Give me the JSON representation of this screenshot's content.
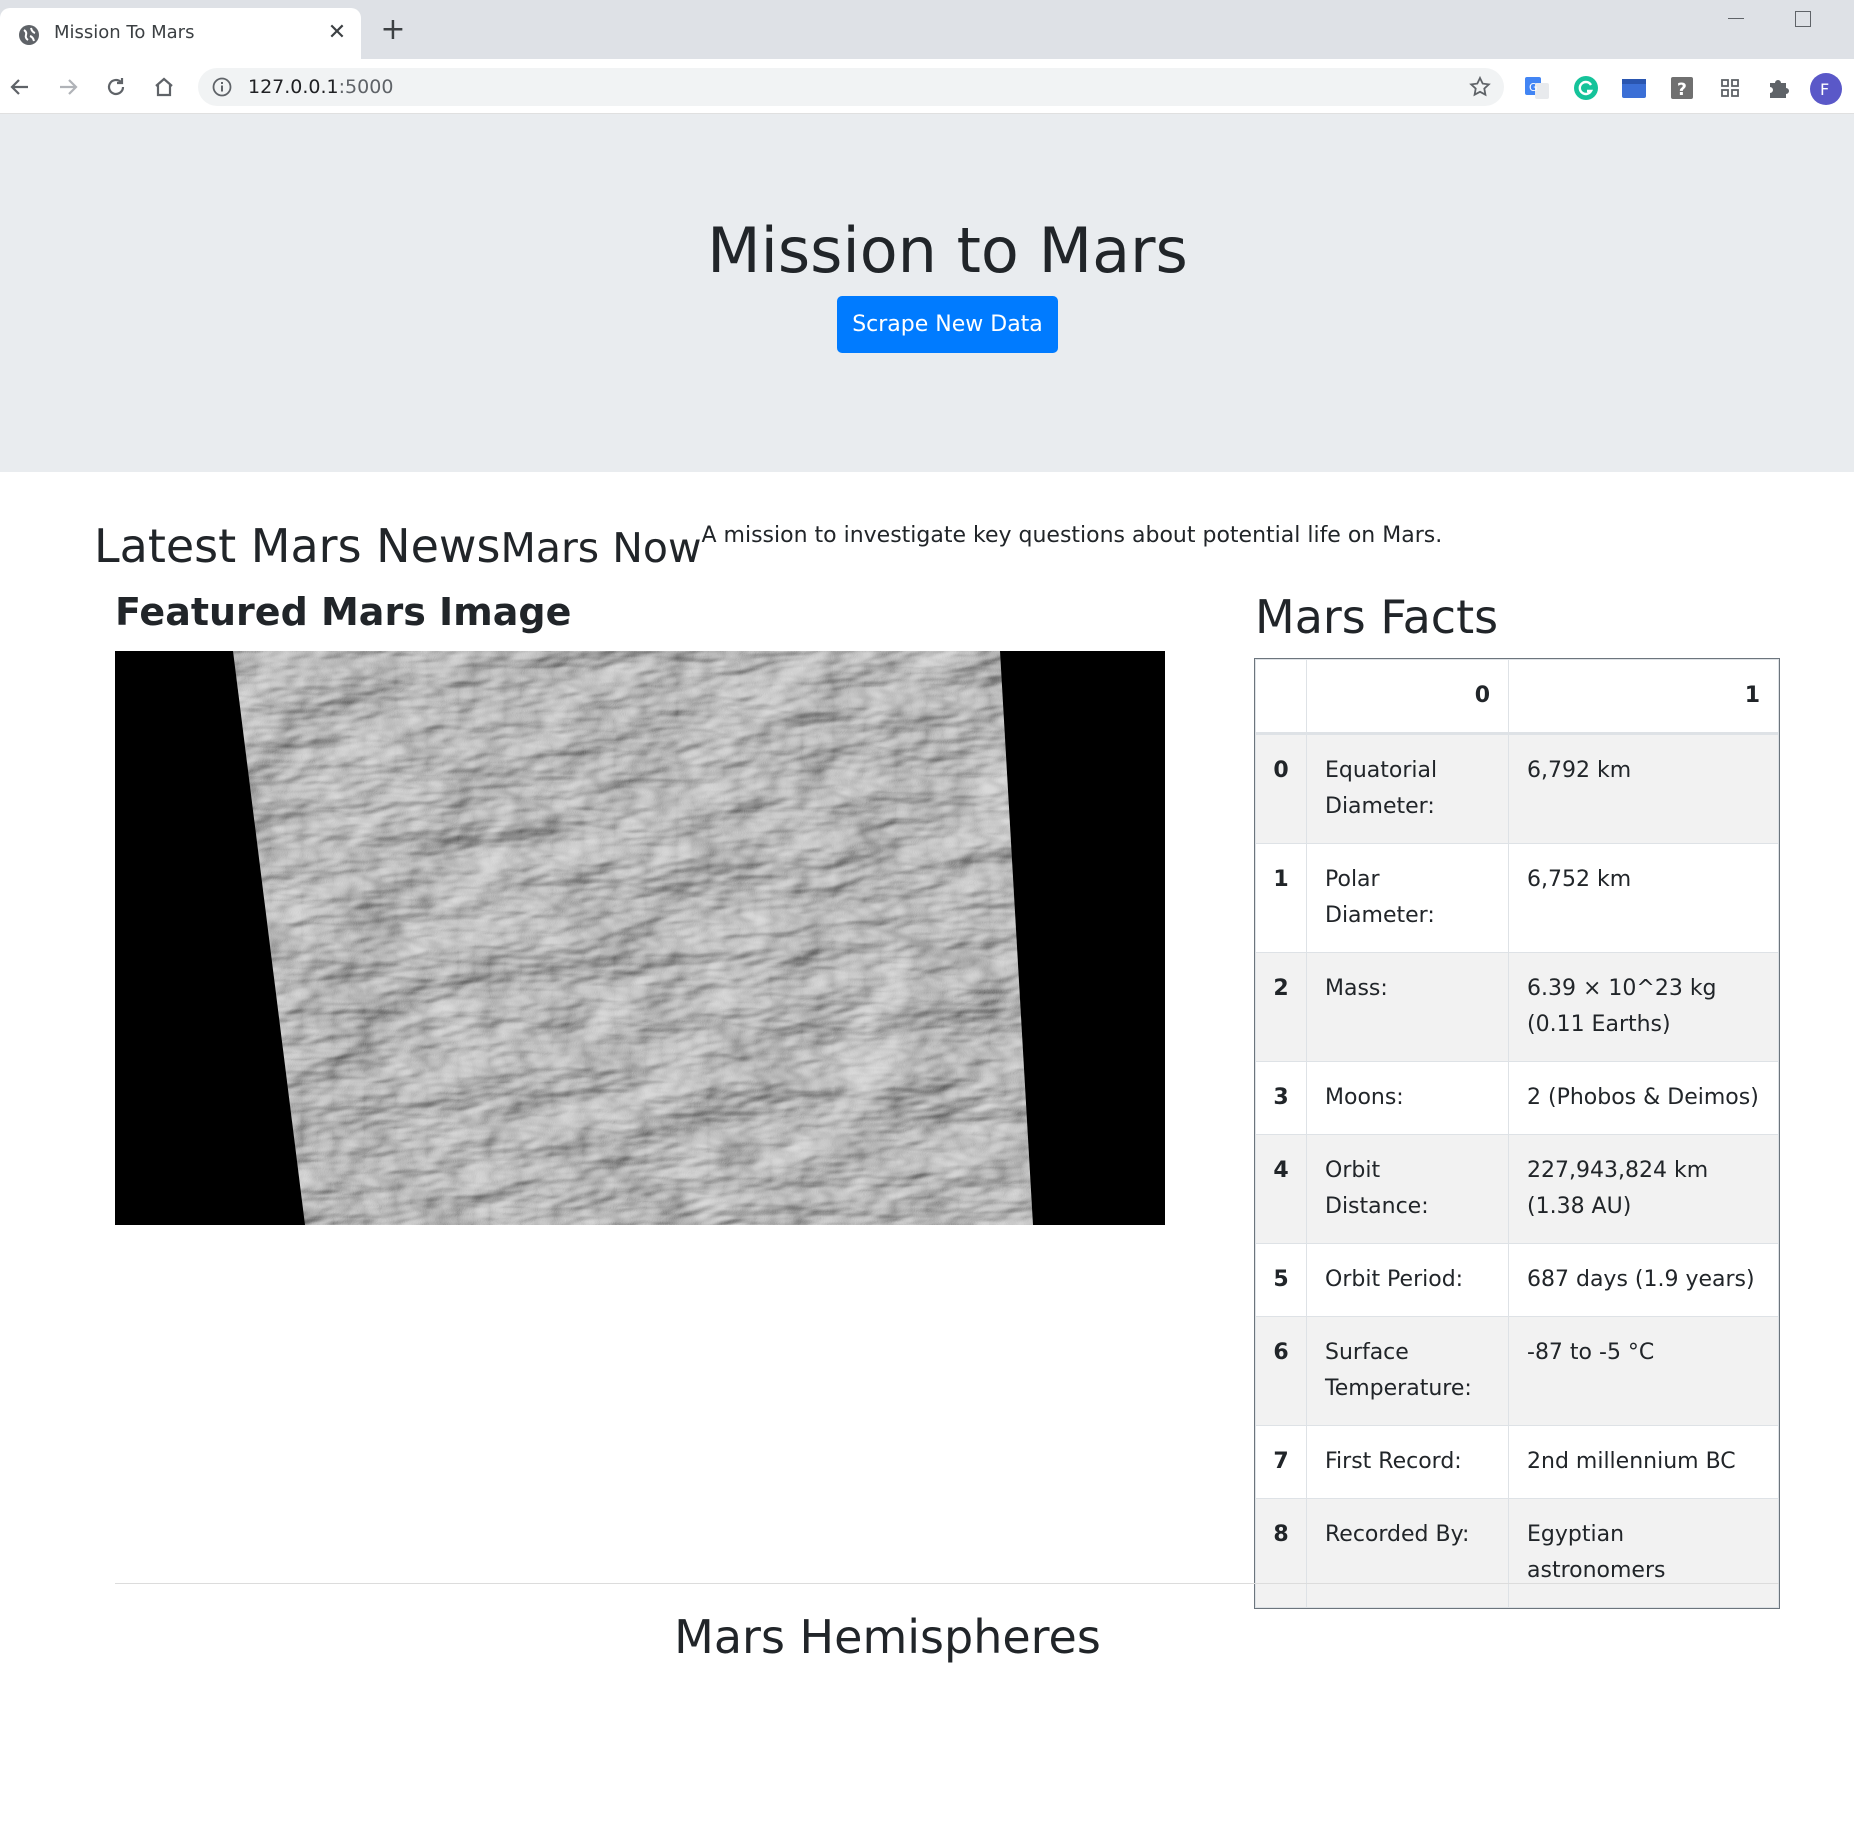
{
  "browser": {
    "tab_title": "Mission To Mars",
    "tab_close_glyph": "✕",
    "new_tab_glyph": "+",
    "url_host": "127.0.0.1",
    "url_port": ":5000"
  },
  "jumbotron": {
    "title": "Mission to Mars",
    "button_label": "Scrape New Data",
    "button_color": "#007bff",
    "background": "#e9ecef"
  },
  "news": {
    "heading": "Latest Mars News",
    "title": "Mars Now",
    "paragraph": "A mission to investigate key questions about potential life on Mars."
  },
  "featured": {
    "heading": "Featured Mars Image"
  },
  "facts": {
    "heading": "Mars Facts",
    "columns": [
      "",
      "0",
      "1"
    ],
    "rows": [
      {
        "index": "0",
        "label": "Equatorial Diameter:",
        "value": "6,792 km"
      },
      {
        "index": "1",
        "label": "Polar Diameter:",
        "value": "6,752 km"
      },
      {
        "index": "2",
        "label": "Mass:",
        "value": "6.39 × 10^23 kg (0.11 Earths)"
      },
      {
        "index": "3",
        "label": "Moons:",
        "value": "2 (Phobos & Deimos)"
      },
      {
        "index": "4",
        "label": "Orbit Distance:",
        "value": "227,943,824 km (1.38 AU)"
      },
      {
        "index": "5",
        "label": "Orbit Period:",
        "value": "687 days (1.9 years)"
      },
      {
        "index": "6",
        "label": "Surface Temperature:",
        "value": "-87 to -5 °C"
      },
      {
        "index": "7",
        "label": "First Record:",
        "value": "2nd millennium BC"
      },
      {
        "index": "8",
        "label": "Recorded By:",
        "value": "Egyptian astronomers"
      }
    ]
  },
  "hemispheres": {
    "heading": "Mars Hemispheres"
  },
  "icons": {
    "favicon": "globe-icon",
    "back": "back-arrow-icon",
    "forward": "forward-arrow-icon",
    "reload": "reload-icon",
    "home": "home-icon",
    "info": "info-icon",
    "star": "star-icon",
    "extensions": [
      "google-translate-icon",
      "grammarly-icon",
      "window-icon",
      "help-icon",
      "grid-icon",
      "puzzle-icon"
    ],
    "profile_letter": "F"
  }
}
